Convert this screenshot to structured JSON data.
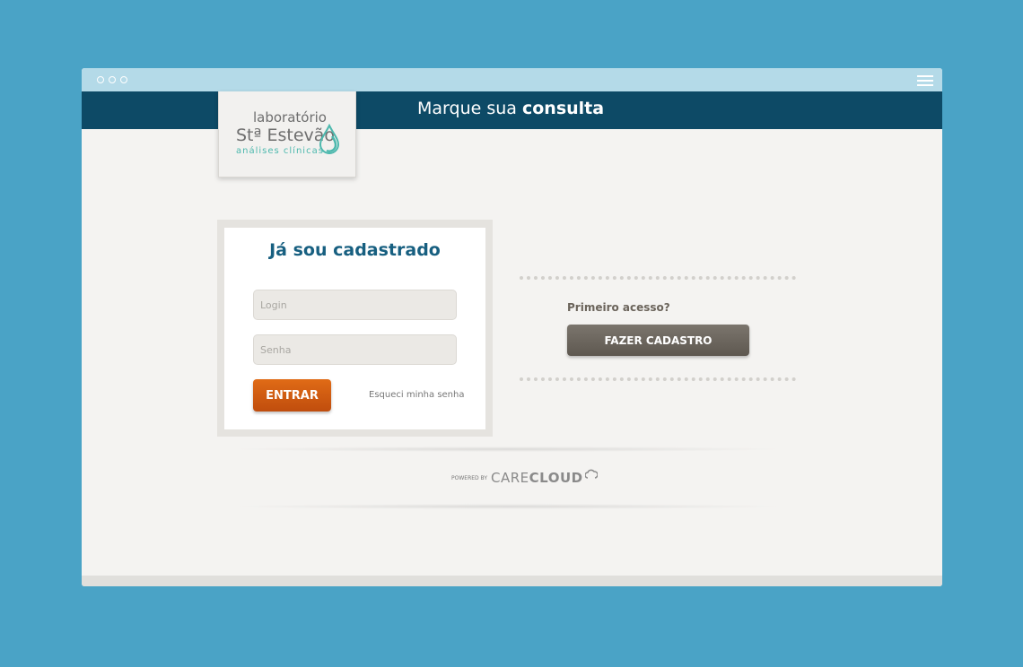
{
  "browser": {
    "window_dots": 3,
    "menu_icon": "hamburger-icon"
  },
  "header": {
    "title_regular": "Marque sua",
    "title_bold": "consulta"
  },
  "logo": {
    "line1": "laboratório",
    "line2": "Stª Estevão",
    "line3": "análises clínicas",
    "icon": "drop-icon"
  },
  "login": {
    "title": "Já sou cadastrado",
    "login_placeholder": "Login",
    "password_placeholder": "Senha",
    "submit_label": "ENTRAR",
    "forgot_label": "Esqueci minha senha"
  },
  "signup": {
    "question": "Primeiro acesso?",
    "button_label": "FAZER CADASTRO"
  },
  "powered": {
    "by_label": "POWERED BY",
    "brand_regular": "CARE",
    "brand_bold": "CLOUD",
    "icon": "cloud-icon"
  },
  "colors": {
    "background": "#4aa3c6",
    "header": "#0d4a66",
    "title_blue": "#175f80",
    "entrar_orange": "#d05a10",
    "cadastro_gray": "#6b655d",
    "logo_teal": "#4cb8ad"
  }
}
